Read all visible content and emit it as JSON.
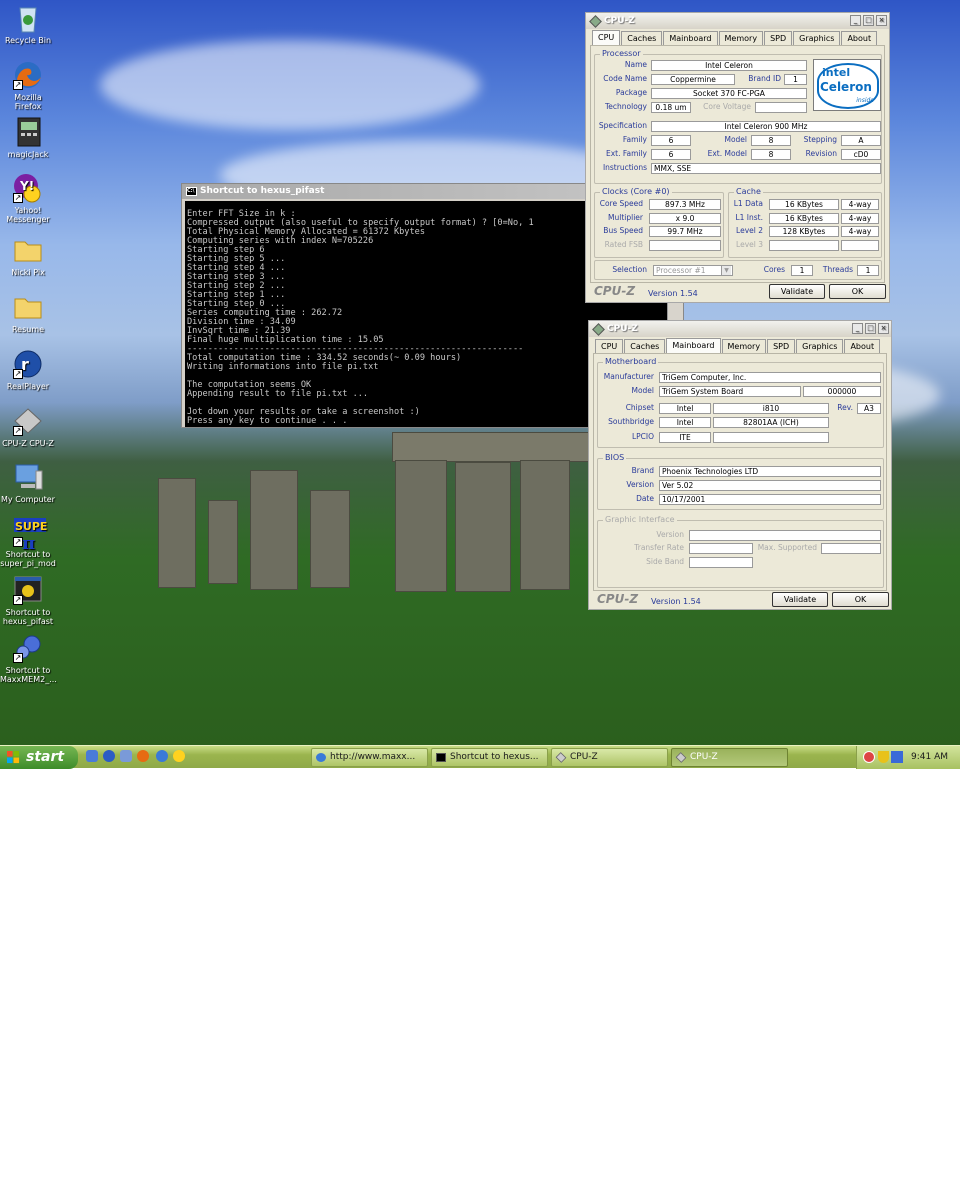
{
  "desktop_icons": [
    {
      "label": "Recycle Bin",
      "icon": "recycle-bin-icon"
    },
    {
      "label": "Mozilla Firefox",
      "icon": "firefox-icon"
    },
    {
      "label": "magicJack",
      "icon": "magicjack-icon"
    },
    {
      "label": "Yahoo! Messenger",
      "icon": "yahoo-messenger-icon"
    },
    {
      "label": "Nicki Pix",
      "icon": "folder-icon"
    },
    {
      "label": "Resume",
      "icon": "folder-icon"
    },
    {
      "label": "RealPlayer",
      "icon": "realplayer-icon"
    },
    {
      "label": "CPU-Z CPU-Z",
      "icon": "cpuz-icon"
    },
    {
      "label": "My Computer",
      "icon": "my-computer-icon"
    },
    {
      "label": "Shortcut to super_pi_mod",
      "icon": "superpi-icon"
    },
    {
      "label": "Shortcut to hexus_pifast",
      "icon": "hexus-pifast-icon"
    },
    {
      "label": "Shortcut to MaxxMEM2_...",
      "icon": "maxxmem-icon"
    }
  ],
  "console": {
    "title": "Shortcut to hexus_pifast",
    "text": "Enter FFT Size in k :\nCompressed output (also useful to specify output format) ? [0=No, 1\nTotal Physical Memory Allocated = 61372 Kbytes\nComputing series with index N=705226\nStarting step 6\nStarting step 5 ...\nStarting step 4 ...\nStarting step 3 ...\nStarting step 2 ...\nStarting step 1 ...\nStarting step 0 ...\nSeries computing time : 262.72\nDivision time : 34.09\nInvSqrt time : 21.39\nFinal huge multiplication time : 15.05\n-----------------------------------------------------------------\nTotal computation time : 334.52 seconds(~ 0.09 hours)\nWriting informations into file pi.txt\n\nThe computation seems OK\nAppending result to file pi.txt ...\n\nJot down your results or take a screenshot :)\nPress any key to continue . . ."
  },
  "cpuz_cpu": {
    "title": "CPU-Z",
    "tabs": [
      "CPU",
      "Caches",
      "Mainboard",
      "Memory",
      "SPD",
      "Graphics",
      "About"
    ],
    "processor_group": "Processor",
    "name_label": "Name",
    "name": "Intel Celeron",
    "codename_label": "Code Name",
    "codename": "Coppermine",
    "brandid_label": "Brand ID",
    "brandid": "1",
    "package_label": "Package",
    "package": "Socket 370 FC-PGA",
    "technology_label": "Technology",
    "technology": "0.18 um",
    "corevoltage_label": "Core Voltage",
    "logo_top": "intel",
    "logo_mid": "Celeron",
    "logo_bot": "inside",
    "spec_label": "Specification",
    "spec": "Intel Celeron 900 MHz",
    "family_label": "Family",
    "family": "6",
    "model_label": "Model",
    "model": "8",
    "stepping_label": "Stepping",
    "stepping": "A",
    "extfamily_label": "Ext. Family",
    "extfamily": "6",
    "extmodel_label": "Ext. Model",
    "extmodel": "8",
    "revision_label": "Revision",
    "revision": "cD0",
    "instructions_label": "Instructions",
    "instructions": "MMX, SSE",
    "clocks_group": "Clocks (Core #0)",
    "corespeed_label": "Core Speed",
    "corespeed": "897.3 MHz",
    "multiplier_label": "Multiplier",
    "multiplier": "x 9.0",
    "busspeed_label": "Bus Speed",
    "busspeed": "99.7 MHz",
    "ratedfsb_label": "Rated FSB",
    "cache_group": "Cache",
    "l1data_label": "L1 Data",
    "l1data": "16 KBytes",
    "l1data_way": "4-way",
    "l1inst_label": "L1 Inst.",
    "l1inst": "16 KBytes",
    "l1inst_way": "4-way",
    "level2_label": "Level 2",
    "level2": "128 KBytes",
    "level2_way": "4-way",
    "level3_label": "Level 3",
    "selection_label": "Selection",
    "selection": "Processor #1",
    "cores_label": "Cores",
    "cores": "1",
    "threads_label": "Threads",
    "threads": "1",
    "brand": "CPU-Z",
    "version": "Version 1.54",
    "validate": "Validate",
    "ok": "OK"
  },
  "cpuz_mb": {
    "title": "CPU-Z",
    "tabs": [
      "CPU",
      "Caches",
      "Mainboard",
      "Memory",
      "SPD",
      "Graphics",
      "About"
    ],
    "mb_group": "Motherboard",
    "manufacturer_label": "Manufacturer",
    "manufacturer": "TriGem Computer, Inc.",
    "model_label": "Model",
    "model": "TriGem System Board",
    "model_rev": "000000",
    "chipset_label": "Chipset",
    "chipset_vendor": "Intel",
    "chipset": "i810",
    "rev_label": "Rev.",
    "rev": "A3",
    "southbridge_label": "Southbridge",
    "sb_vendor": "Intel",
    "sb": "82801AA (ICH)",
    "lpcio_label": "LPCIO",
    "lpcio": "ITE",
    "bios_group": "BIOS",
    "brand_label": "Brand",
    "bios_brand": "Phoenix Technologies LTD",
    "version_label": "Version",
    "bios_version": "Ver 5.02",
    "date_label": "Date",
    "bios_date": "10/17/2001",
    "gi_group": "Graphic Interface",
    "gi_version_label": "Version",
    "gi_transfer_label": "Transfer Rate",
    "gi_max_label": "Max. Supported",
    "gi_side_label": "Side Band",
    "brand": "CPU-Z",
    "version": "Version 1.54",
    "validate": "Validate",
    "ok": "OK"
  },
  "taskbar": {
    "start": "start",
    "buttons": [
      {
        "label": "http://www.maxx...",
        "icon": "ie-icon"
      },
      {
        "label": "Shortcut to hexus...",
        "icon": "console-icon"
      },
      {
        "label": "CPU-Z",
        "icon": "cpuz-icon"
      },
      {
        "label": "CPU-Z",
        "icon": "cpuz-icon"
      }
    ],
    "clock": "9:41 AM"
  },
  "colors": {
    "label_blue": "#2a3b9a",
    "xp_green": "#3d8c2a",
    "taskbar": "#9bb54e"
  }
}
